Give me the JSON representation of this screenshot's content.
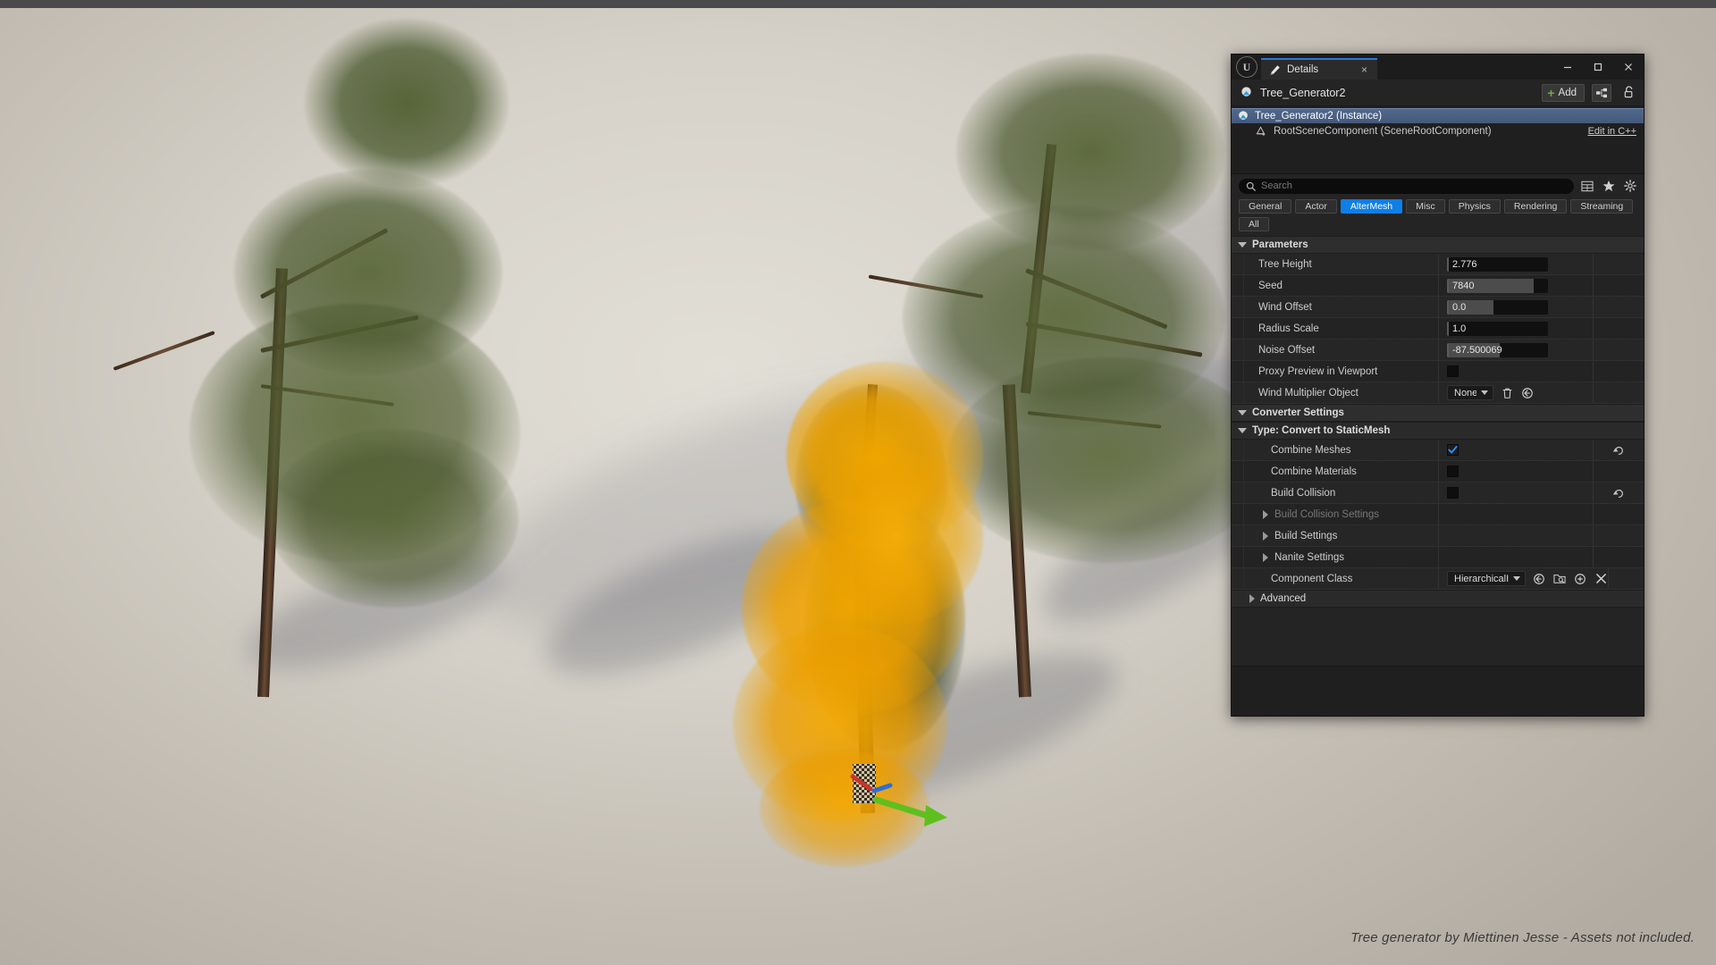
{
  "app": {
    "engine_logo": "unreal-engine-logo",
    "tab_label": "Details",
    "tab_close": "×",
    "window_minimize": "minimize-icon",
    "window_maximize": "maximize-icon",
    "window_close": "close-icon"
  },
  "actor": {
    "name": "Tree_Generator2",
    "add_label": "Add",
    "add_icon": "plus-icon",
    "blueprint_icon": "blueprint-icon",
    "lock_icon": "unlock-icon"
  },
  "outliner": {
    "rows": [
      {
        "label": "Tree_Generator2 (Instance)",
        "icon": "actor-sphere-icon",
        "selected": true,
        "action": ""
      },
      {
        "label": "RootSceneComponent (SceneRootComponent)",
        "icon": "scene-component-icon",
        "selected": false,
        "action": "Edit in C++"
      }
    ]
  },
  "search": {
    "icon": "search-icon",
    "value": "",
    "placeholder": "Search",
    "tools": [
      "columns-icon",
      "favorites-star-icon",
      "settings-gear-icon"
    ]
  },
  "filters": {
    "chips": [
      {
        "label": "General",
        "active": false
      },
      {
        "label": "Actor",
        "active": false
      },
      {
        "label": "AlterMesh",
        "active": true
      },
      {
        "label": "Misc",
        "active": false
      },
      {
        "label": "Physics",
        "active": false
      },
      {
        "label": "Rendering",
        "active": false
      },
      {
        "label": "Streaming",
        "active": false
      },
      {
        "label": "All",
        "active": false
      }
    ],
    "accent_color": "#0d7fe8"
  },
  "sections": {
    "parameters_title": "Parameters",
    "converter_title": "Converter Settings",
    "type_title": "Type: Convert to StaticMesh",
    "advanced_title": "Advanced"
  },
  "parameters": [
    {
      "label": "Tree Height",
      "type": "number",
      "value": "2.776",
      "fill": 2
    },
    {
      "label": "Seed",
      "type": "number",
      "value": "7840",
      "fill": 86
    },
    {
      "label": "Wind Offset",
      "type": "number",
      "value": "0.0",
      "fill": 46
    },
    {
      "label": "Radius Scale",
      "type": "number",
      "value": "1.0",
      "fill": 2
    },
    {
      "label": "Noise Offset",
      "type": "number",
      "value": "-87.500069",
      "fill": 52
    },
    {
      "label": "Proxy Preview in Viewport",
      "type": "checkbox",
      "value": "",
      "checked": false
    },
    {
      "label": "Wind Multiplier Object",
      "type": "object",
      "value": "None",
      "buttons": [
        "trash-icon",
        "reset-to-default-icon"
      ]
    }
  ],
  "converter_rows": [
    {
      "label": "Combine Meshes",
      "type": "checkbox",
      "checked": true,
      "reset": true,
      "dim": false
    },
    {
      "label": "Combine Materials",
      "type": "checkbox",
      "checked": false,
      "reset": false,
      "dim": false
    },
    {
      "label": "Build Collision",
      "type": "checkbox",
      "checked": false,
      "reset": true,
      "dim": false
    },
    {
      "label": "Build Collision Settings",
      "type": "expander",
      "checked": false,
      "reset": false,
      "dim": true
    },
    {
      "label": "Build Settings",
      "type": "expander",
      "checked": false,
      "reset": false,
      "dim": false
    },
    {
      "label": "Nanite Settings",
      "type": "expander",
      "checked": false,
      "reset": false,
      "dim": false
    },
    {
      "label": "Component Class",
      "type": "class",
      "value": "HierarchicalIn",
      "buttons": [
        "reset-to-default-icon",
        "browse-asset-icon",
        "use-selected-icon",
        "clear-icon"
      ]
    }
  ],
  "viewport": {
    "watermark": "Tree generator by Miettinen Jesse - Assets not included.",
    "background_color": "#c3bdb3",
    "foliage_yellow": "#f0a400",
    "foliage_green": "#4e5c33",
    "trunk_color": "#4e382a",
    "gizmo_axis_colors": {
      "x": "#c8342a",
      "y": "#5fbf1f",
      "z": "#2a6fd4"
    }
  }
}
